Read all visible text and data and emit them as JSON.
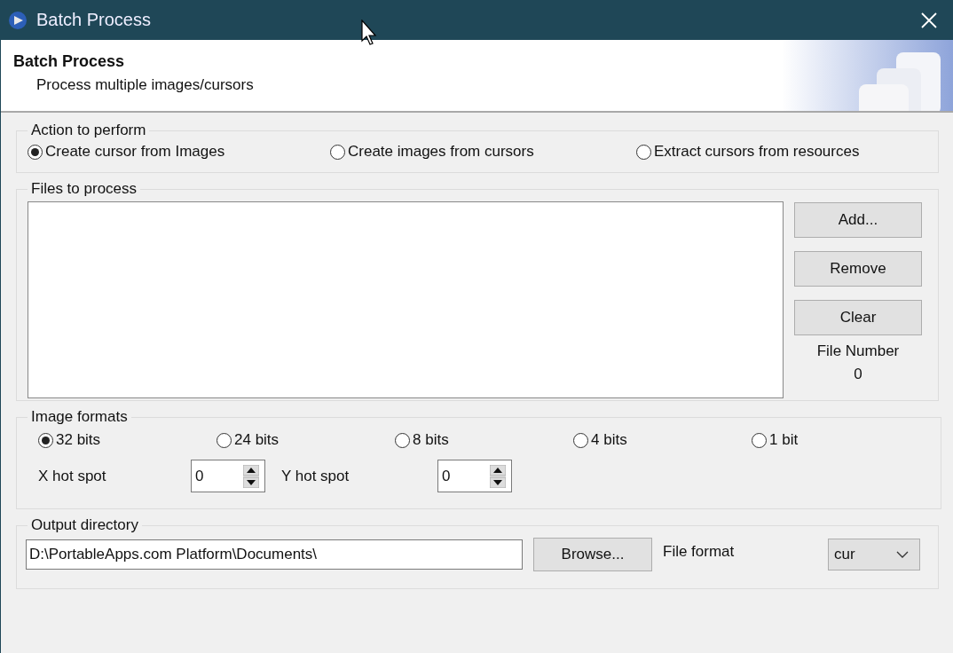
{
  "window": {
    "title": "Batch Process"
  },
  "header": {
    "title": "Batch Process",
    "subtitle": "Process multiple images/cursors"
  },
  "action_group": {
    "title": "Action to perform",
    "options": [
      {
        "label": "Create cursor from Images",
        "selected": true
      },
      {
        "label": "Create images from cursors",
        "selected": false
      },
      {
        "label": "Extract cursors from resources",
        "selected": false
      }
    ]
  },
  "files_group": {
    "title": "Files to process",
    "buttons": [
      "Add...",
      "Remove",
      "Clear"
    ],
    "file_number_label": "File Number",
    "file_number": "0"
  },
  "formats_group": {
    "title": "Image formats",
    "options": [
      {
        "label": "32 bits",
        "selected": true
      },
      {
        "label": "24 bits",
        "selected": false
      },
      {
        "label": "8 bits",
        "selected": false
      },
      {
        "label": "4 bits",
        "selected": false
      },
      {
        "label": "1 bit",
        "selected": false
      }
    ],
    "x_hot_spot": {
      "label": "X hot spot",
      "value": "0"
    },
    "y_hot_spot": {
      "label": "Y hot spot",
      "value": "0"
    }
  },
  "output_group": {
    "title": "Output directory",
    "path": "D:\\PortableApps.com Platform\\Documents\\",
    "browse": "Browse...",
    "file_format_label": "File format",
    "file_format": "cur"
  }
}
